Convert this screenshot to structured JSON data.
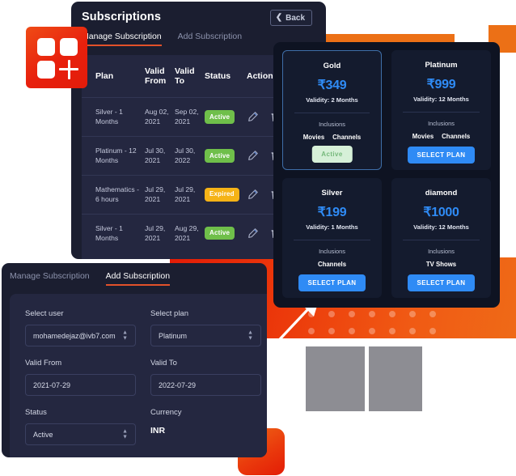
{
  "subscriptions_panel": {
    "title": "Subscriptions",
    "back_label": "Back",
    "tabs": [
      {
        "label": "Manage Subscription",
        "active": true
      },
      {
        "label": "Add Subscription",
        "active": false
      }
    ],
    "table": {
      "headers": [
        "Plan",
        "Valid From",
        "Valid To",
        "Status",
        "Actions"
      ],
      "rows": [
        {
          "plan": "Silver - 1 Months",
          "valid_from": "Aug 02, 2021",
          "valid_to": "Sep 02, 2021",
          "status": "Active",
          "status_kind": "active"
        },
        {
          "plan": "Platinum - 12 Months",
          "valid_from": "Jul 30, 2021",
          "valid_to": "Jul 30, 2022",
          "status": "Active",
          "status_kind": "active"
        },
        {
          "plan": "Mathematics - 6 hours",
          "valid_from": "Jul 29, 2021",
          "valid_to": "Jul 29, 2021",
          "status": "Expired",
          "status_kind": "expired"
        },
        {
          "plan": "Silver - 1 Months",
          "valid_from": "Jul 29, 2021",
          "valid_to": "Aug 29, 2021",
          "status": "Active",
          "status_kind": "active"
        }
      ]
    }
  },
  "plans_panel": {
    "inclusions_label": "Inclusions",
    "plans": [
      {
        "name": "Gold",
        "price": "₹349",
        "validity": "Validity: 2 Months",
        "inclusions": [
          "Movies",
          "Channels"
        ],
        "cta": "Active",
        "cta_kind": "current",
        "highlight": true
      },
      {
        "name": "Platinum",
        "price": "₹999",
        "validity": "Validity: 12 Months",
        "inclusions": [
          "Movies",
          "Channels"
        ],
        "cta": "SELECT PLAN",
        "cta_kind": "select",
        "highlight": false
      },
      {
        "name": "Silver",
        "price": "₹199",
        "validity": "Validity: 1 Months",
        "inclusions": [
          "Channels"
        ],
        "cta": "SELECT PLAN",
        "cta_kind": "select",
        "highlight": false
      },
      {
        "name": "diamond",
        "price": "₹1000",
        "validity": "Validity: 12 Months",
        "inclusions": [
          "TV Shows"
        ],
        "cta": "SELECT PLAN",
        "cta_kind": "select",
        "highlight": false
      }
    ]
  },
  "add_panel": {
    "tabs": [
      {
        "label": "Manage Subscription",
        "active": false
      },
      {
        "label": "Add Subscription",
        "active": true
      }
    ],
    "fields": {
      "select_user": {
        "label": "Select user",
        "value": "mohamedejaz@ivb7.com",
        "control": "select"
      },
      "select_plan": {
        "label": "Select plan",
        "value": "Platinum",
        "control": "select"
      },
      "valid_from": {
        "label": "Valid From",
        "value": "2021-07-29",
        "control": "input"
      },
      "valid_to": {
        "label": "Valid To",
        "value": "2022-07-29",
        "control": "input"
      },
      "status": {
        "label": "Status",
        "value": "Active",
        "control": "select"
      },
      "currency": {
        "label": "Currency",
        "value": "INR",
        "control": "text"
      }
    }
  },
  "decorations": {
    "logo": "app-grid-plus-logo",
    "arrow": "callout-arrow",
    "dot_grid": {
      "rows": 2,
      "cols": 7
    }
  },
  "colors": {
    "accent_orange": "#ec7016",
    "accent_red": "#e31c06",
    "panel_bg": "#1b1e30",
    "card_bg": "#242740",
    "plans_bg": "#0e1322",
    "plan_card_bg": "#141b2e",
    "blue": "#2f8bf5",
    "green": "#6fbf4a",
    "amber": "#f5b316",
    "tab_underline": "#e2512a"
  }
}
